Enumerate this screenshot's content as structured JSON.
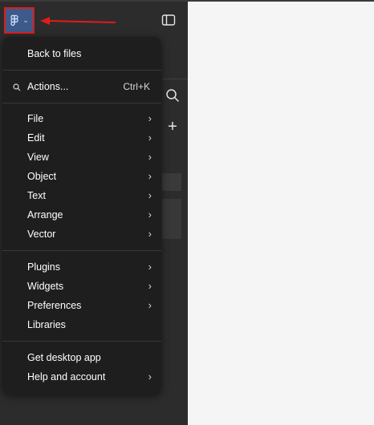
{
  "menu": {
    "back": "Back to files",
    "actions": {
      "label": "Actions...",
      "shortcut": "Ctrl+K"
    },
    "group1": [
      {
        "label": "File",
        "submenu": true
      },
      {
        "label": "Edit",
        "submenu": true
      },
      {
        "label": "View",
        "submenu": true
      },
      {
        "label": "Object",
        "submenu": true
      },
      {
        "label": "Text",
        "submenu": true
      },
      {
        "label": "Arrange",
        "submenu": true
      },
      {
        "label": "Vector",
        "submenu": true
      }
    ],
    "group2": [
      {
        "label": "Plugins",
        "submenu": true
      },
      {
        "label": "Widgets",
        "submenu": true
      },
      {
        "label": "Preferences",
        "submenu": true
      },
      {
        "label": "Libraries",
        "submenu": false
      }
    ],
    "group3": [
      {
        "label": "Get desktop app",
        "submenu": false
      },
      {
        "label": "Help and account",
        "submenu": true
      }
    ],
    "chevron": "›"
  },
  "colors": {
    "sidebar": "#2c2c2c",
    "menu_bg": "#1e1e1e",
    "highlight_box": "#e11b1b",
    "main_button": "#3d5a8a",
    "canvas": "#f5f5f5"
  },
  "icons": {
    "main_menu": "figma-logo-icon",
    "dropdown": "chevron-down-icon",
    "panel": "sidebar-toggle-icon",
    "search": "search-icon",
    "add": "plus-icon",
    "annotation": "red-arrow-icon"
  }
}
